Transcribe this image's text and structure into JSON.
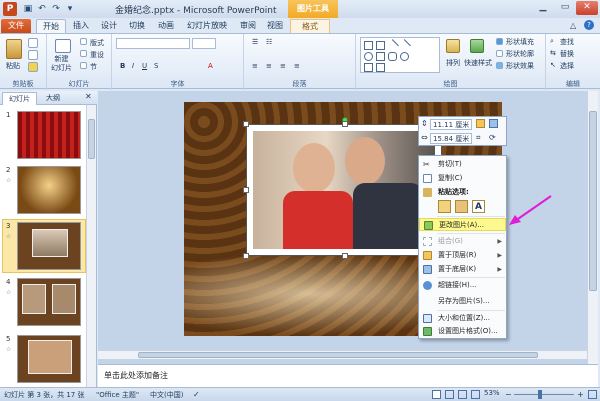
{
  "window": {
    "title": "金婚纪念.pptx - Microsoft PowerPoint",
    "context_tab": "图片工具"
  },
  "tabs": [
    "文件",
    "开始",
    "插入",
    "设计",
    "切换",
    "动画",
    "幻灯片放映",
    "审阅",
    "视图",
    "格式"
  ],
  "ribbon": {
    "clipboard": {
      "label": "剪贴板",
      "paste": "粘贴"
    },
    "slides": {
      "label": "幻灯片",
      "new_slide": "新建\n幻灯片",
      "layout": "版式",
      "reset": "重设",
      "section": "节"
    },
    "font": {
      "label": "字体"
    },
    "paragraph": {
      "label": "段落"
    },
    "drawing": {
      "label": "绘图",
      "arrange": "排列",
      "quick_styles": "快速样式",
      "shape_fill": "形状填充",
      "shape_outline": "形状轮廓",
      "shape_effects": "形状效果"
    },
    "editing": {
      "label": "编辑",
      "find": "查找",
      "replace": "替换",
      "select": "选择"
    }
  },
  "pane": {
    "tab_slides": "幻灯片",
    "tab_outline": "大纲",
    "slide_numbers": [
      "1",
      "2",
      "3",
      "4",
      "5"
    ]
  },
  "mini_toolbar": {
    "height": "11.11 厘米",
    "width": "15.84 厘米"
  },
  "context_menu": {
    "cut": "剪切(T)",
    "copy": "复制(C)",
    "paste_options": "粘贴选项:",
    "change_picture": "更改图片(A)...",
    "group": "组合(G)",
    "bring_front": "置于顶层(R)",
    "send_back": "置于底层(K)",
    "hyperlink": "超链接(H)...",
    "save_as": "另存为图片(S)...",
    "size_pos": "大小和位置(Z)...",
    "format_pic": "设置图片格式(O)..."
  },
  "notes_placeholder": "单击此处添加备注",
  "status": {
    "slide_info": "幻灯片 第 3 张，共 17 张",
    "theme": "\"Office 主题\"",
    "lang": "中文(中国)",
    "zoom": "53%"
  },
  "colors": {
    "accent_file": "#c74a1b",
    "context_orange": "#f3a927",
    "highlight": "#fdf98e",
    "arrow": "#e01cd6"
  }
}
